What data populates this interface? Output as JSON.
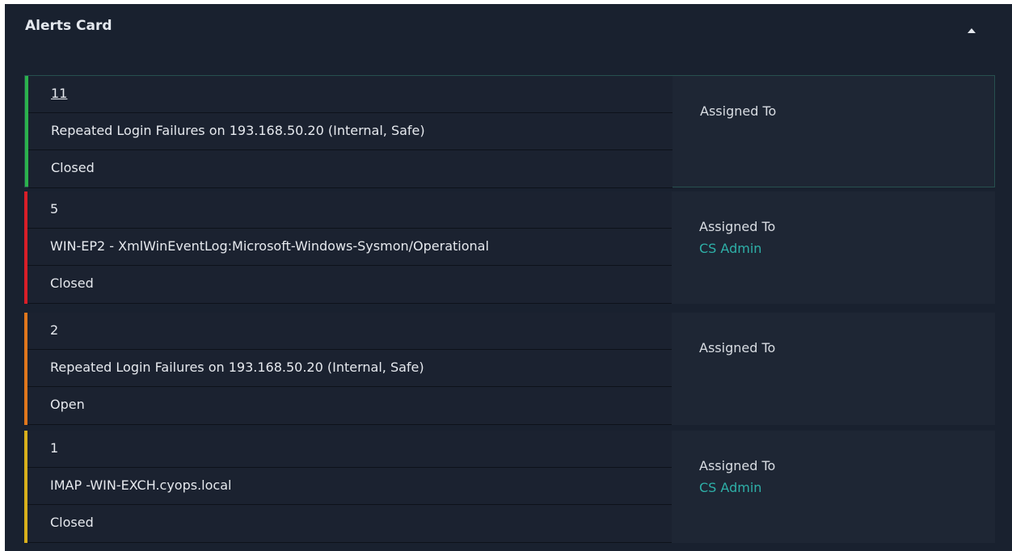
{
  "card": {
    "title": "Alerts Card",
    "collapse_icon": "caret-up-icon"
  },
  "alerts": [
    {
      "id": "11",
      "name": "Repeated Login Failures on 193.168.50.20 (Internal, Safe)",
      "status": "Closed",
      "severity_color": "#2bb24c",
      "assigned_label": "Assigned To",
      "assigned_to": ""
    },
    {
      "id": "5",
      "name": "WIN-EP2 - XmlWinEventLog:Microsoft-Windows-Sysmon/Operational",
      "status": "Closed",
      "severity_color": "#d91e28",
      "assigned_label": "Assigned To",
      "assigned_to": "CS Admin"
    },
    {
      "id": "2",
      "name": "Repeated Login Failures on 193.168.50.20 (Internal, Safe)",
      "status": "Open",
      "severity_color": "#e0771d",
      "assigned_label": "Assigned To",
      "assigned_to": ""
    },
    {
      "id": "1",
      "name": "IMAP -WIN-EXCH.cyops.local",
      "status": "Closed",
      "severity_color": "#d9b01c",
      "assigned_label": "Assigned To",
      "assigned_to": "CS Admin"
    }
  ],
  "colors": {
    "background": "#19212f",
    "accent_link": "#2eb0a8"
  }
}
